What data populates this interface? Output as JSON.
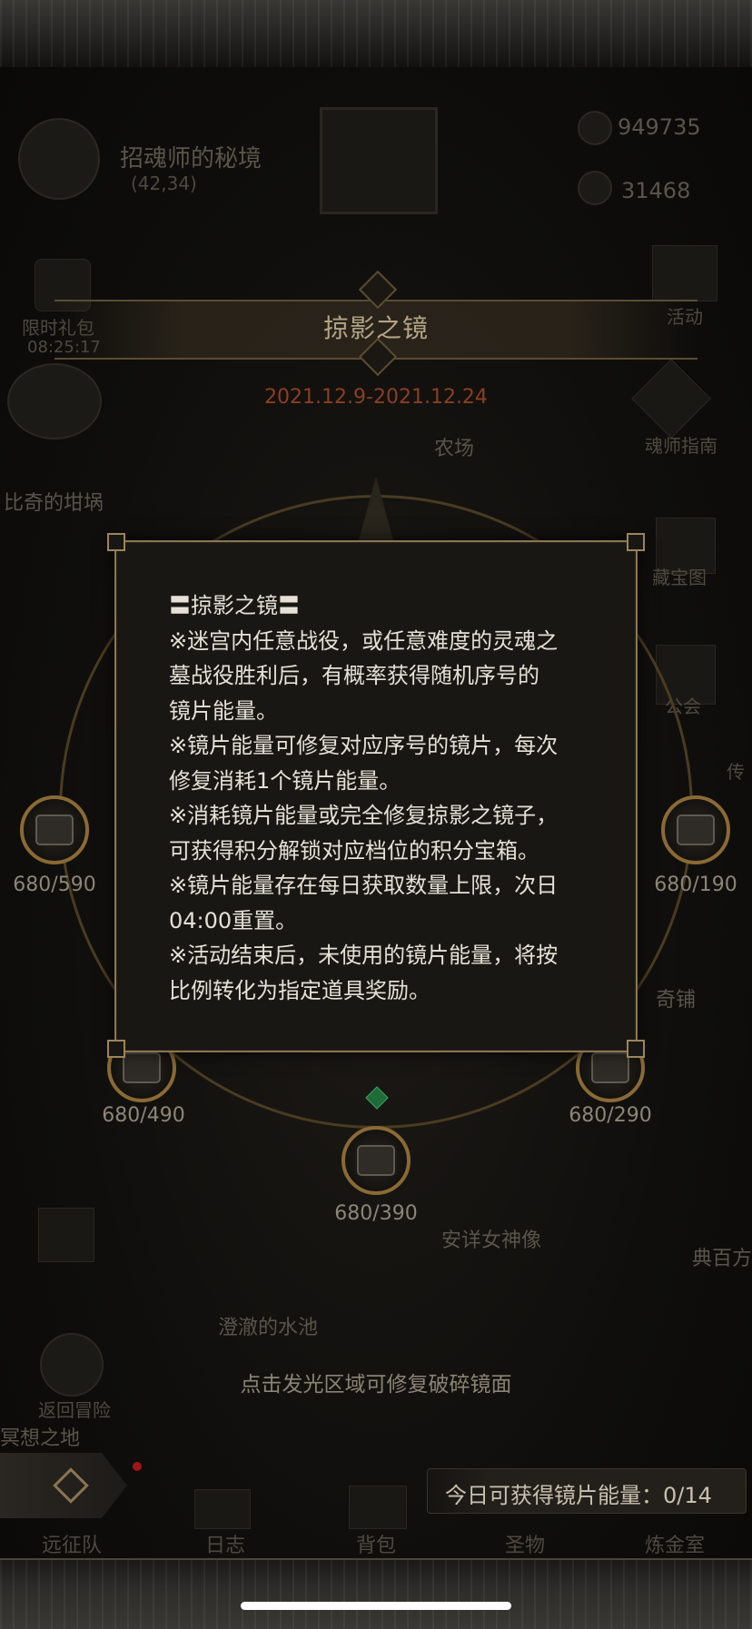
{
  "top": {
    "location_name": "招魂师的秘境",
    "location_coords": "(42,34)",
    "currency_1": "949735",
    "currency_2": "31468"
  },
  "side_left": {
    "limited_gift": "限时礼包",
    "gift_timer": "08:25:17",
    "area_1": "比奇的坩埚",
    "return_label": "返回冒险",
    "area_2": "冥想之地"
  },
  "side_right": {
    "activity": "活动",
    "guide": "魂师指南",
    "treasure": "藏宝图",
    "guild": "公会",
    "shop": "奇铺",
    "cut_text": "传",
    "area": "典百方"
  },
  "background_labels": {
    "farm": "农场",
    "goddess": "安详女神像",
    "pool": "澄澈的水池"
  },
  "event": {
    "title": "掠影之镜",
    "date_range": "2021.12.9-2021.12.24"
  },
  "chests": [
    {
      "label": "680/590"
    },
    {
      "label": "680/190"
    },
    {
      "label": "680/490"
    },
    {
      "label": "680/290"
    },
    {
      "label": "680/390"
    }
  ],
  "popup": {
    "heading": "〓掠影之镜〓",
    "lines": [
      "※迷宫内任意战役，或任意难度的灵魂之",
      "墓战役胜利后，有概率获得随机序号的",
      "镜片能量。",
      "※镜片能量可修复对应序号的镜片，每次",
      "修复消耗1个镜片能量。",
      "※消耗镜片能量或完全修复掠影之镜子，",
      "可获得积分解锁对应档位的积分宝箱。",
      "※镜片能量存在每日获取数量上限，次日",
      "04:00重置。",
      "※活动结束后，未使用的镜片能量，将按",
      "比例转化为指定道具奖励。"
    ]
  },
  "hint": "点击发光区域可修复破碎镜面",
  "energy": "今日可获得镜片能量：0/14",
  "bottom_nav": [
    {
      "label": "远征队",
      "icon": "expedition-icon"
    },
    {
      "label": "日志",
      "icon": "journal-icon"
    },
    {
      "label": "背包",
      "icon": "backpack-icon"
    },
    {
      "label": "圣物",
      "icon": "relic-icon"
    },
    {
      "label": "炼金室",
      "icon": "alchemy-icon"
    }
  ],
  "colors": {
    "accent_gold": "#8b7552",
    "date_red": "#8a3f24",
    "popup_bg": "#191714",
    "popup_text": "#e6e0d6"
  }
}
